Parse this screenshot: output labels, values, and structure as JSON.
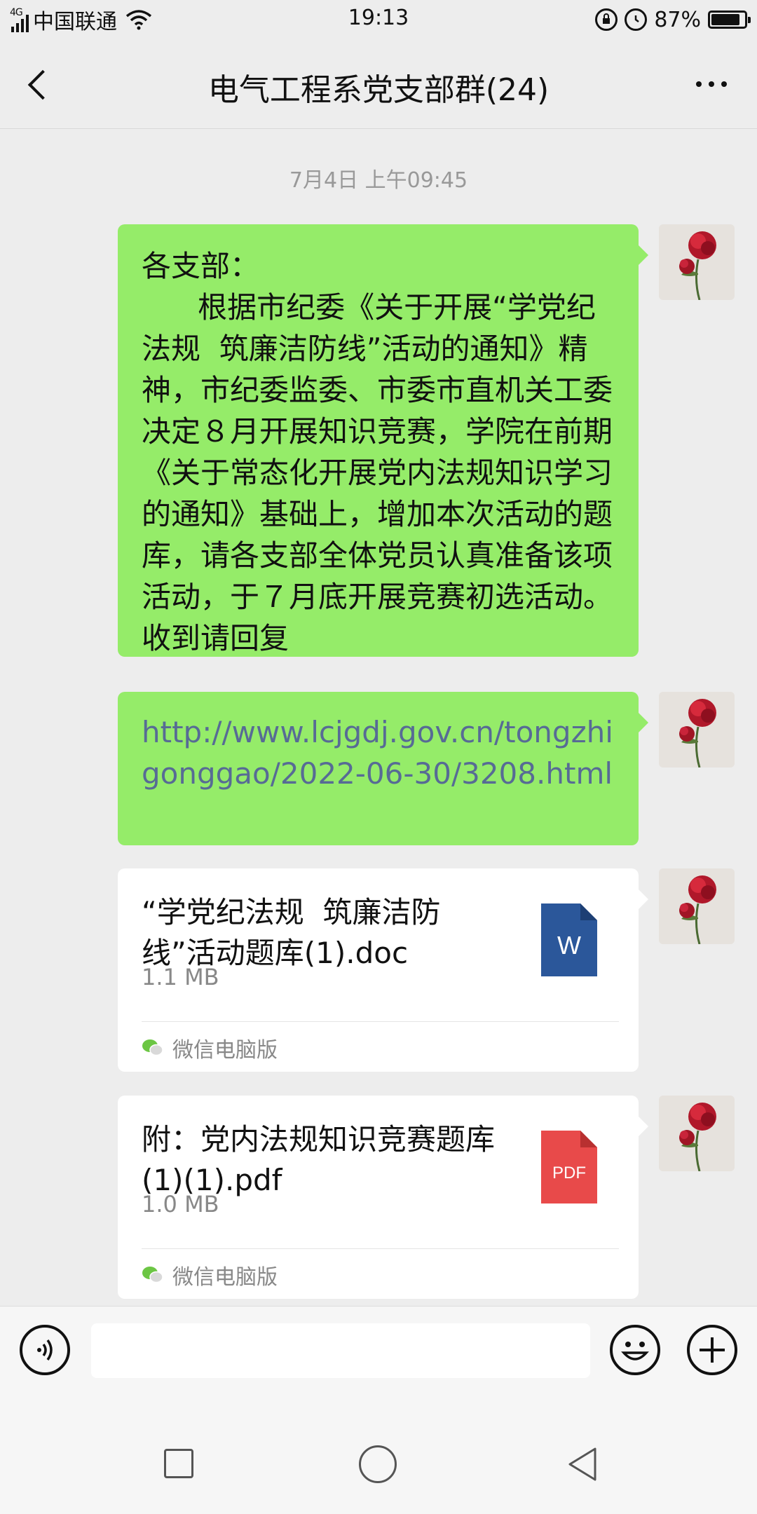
{
  "status_bar": {
    "network_type": "4G",
    "carrier": "中国联通",
    "time": "19:13",
    "battery_percent": "87%",
    "battery_level": 0.87,
    "icons": [
      "signal-icon",
      "wifi-icon",
      "lock-rotation-icon",
      "alarm-icon",
      "battery-icon"
    ]
  },
  "header": {
    "title": "电气工程系党支部群(24)",
    "back_icon": "chevron-left-icon",
    "more_icon": "more-icon"
  },
  "chat": {
    "timestamp": "7月4日 上午09:45",
    "messages": [
      {
        "type": "text",
        "sender_avatar": "rose-avatar",
        "text": "各支部：\n      根据市纪委《关于开展“学党纪法规  筑廉洁防线”活动的通知》精神，市纪委监委、市委市直机关工委决定８月开展知识竞赛，学院在前期《关于常态化开展党内法规知识学习的通知》基础上，增加本次活动的题库，请各支部全体党员认真准备该项活动，于７月底开展竞赛初选活动。收到请回复"
      },
      {
        "type": "link",
        "sender_avatar": "rose-avatar",
        "text": "http://www.lcjgdj.gov.cn/tongzhigonggao/2022-06-30/3208.html"
      },
      {
        "type": "file",
        "sender_avatar": "rose-avatar",
        "file_name": "“学党纪法规  筑廉洁防线”活动题库(1).doc",
        "file_size": "1.1 MB",
        "source": "微信电脑版",
        "file_icon": "word-file-icon",
        "icon_label": "W",
        "icon_color": "#2b579a"
      },
      {
        "type": "file",
        "sender_avatar": "rose-avatar",
        "file_name": "附：党内法规知识竞赛题库(1)(1).pdf",
        "file_size": "1.0 MB",
        "source": "微信电脑版",
        "file_icon": "pdf-file-icon",
        "icon_label": "PDF",
        "icon_color": "#e84a4a"
      }
    ]
  },
  "input_bar": {
    "voice_icon": "voice-icon",
    "emoji_icon": "emoji-icon",
    "plus_icon": "plus-icon",
    "text_value": ""
  },
  "nav_bar": {
    "buttons": [
      "recent-apps-icon",
      "home-icon",
      "back-triangle-icon"
    ]
  },
  "colors": {
    "background": "#ededed",
    "sent_bubble": "#95ec69",
    "link": "#576b95",
    "file_bubble": "#ffffff"
  }
}
